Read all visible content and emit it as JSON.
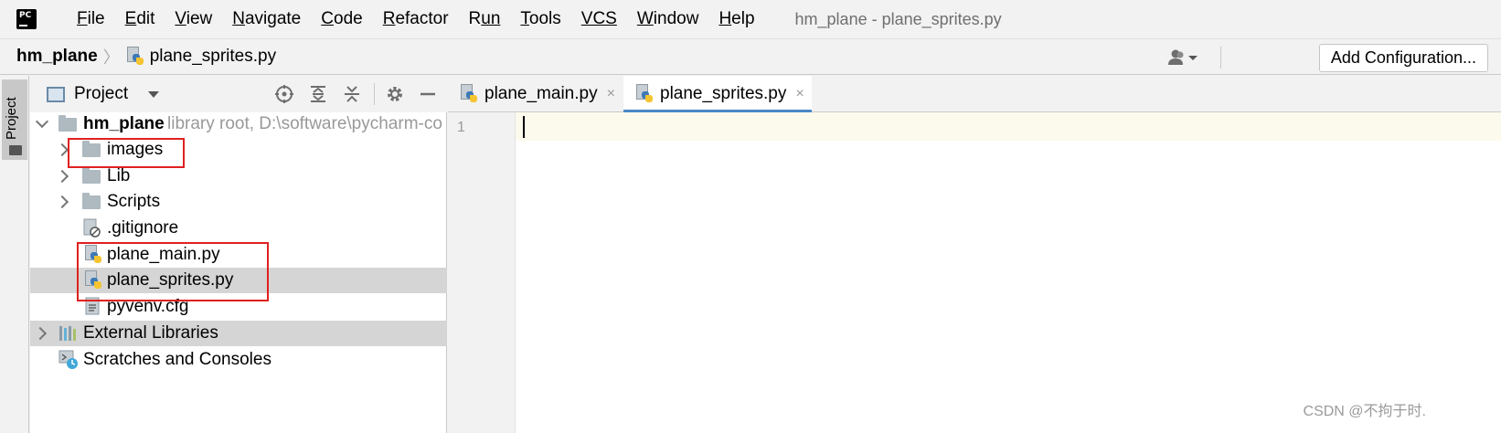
{
  "menubar": {
    "items": [
      {
        "mnemonic": "F",
        "rest": "ile"
      },
      {
        "mnemonic": "E",
        "rest": "dit"
      },
      {
        "mnemonic": "V",
        "rest": "iew"
      },
      {
        "mnemonic": "N",
        "rest": "avigate"
      },
      {
        "mnemonic": "C",
        "rest": "ode"
      },
      {
        "mnemonic": "R",
        "rest": "efactor"
      },
      {
        "mnemonic": "R",
        "rest": "un"
      },
      {
        "mnemonic": "T",
        "rest": "ools"
      },
      {
        "mnemonic": "VCS",
        "rest": ""
      },
      {
        "mnemonic": "W",
        "rest": "indow"
      },
      {
        "mnemonic": "H",
        "rest": "elp"
      }
    ],
    "window_title": "hm_plane - plane_sprites.py"
  },
  "navbar": {
    "root": "hm_plane",
    "separator": "〉",
    "file": "plane_sprites.py",
    "add_configuration": "Add Configuration..."
  },
  "toolstrip": {
    "project_label": "Project"
  },
  "project_panel": {
    "title": "Project",
    "tree": {
      "root_name": "hm_plane",
      "root_hint": "library root,  D:\\software\\pycharm-co",
      "images": "images",
      "lib": "Lib",
      "scripts": "Scripts",
      "gitignore": ".gitignore",
      "plane_main": "plane_main.py",
      "plane_sprites": "plane_sprites.py",
      "pyvenv": "pyvenv.cfg",
      "external_libraries": "External Libraries",
      "scratches": "Scratches and Consoles"
    }
  },
  "editor": {
    "tabs": [
      {
        "label": "plane_main.py",
        "close": "×"
      },
      {
        "label": "plane_sprites.py",
        "close": "×"
      }
    ],
    "line_number": "1",
    "accent": "#4a88c7",
    "current_line_bg": "#fcfaed"
  },
  "watermark": "CSDN @不拘于时.",
  "highlight_color": "#e02020"
}
